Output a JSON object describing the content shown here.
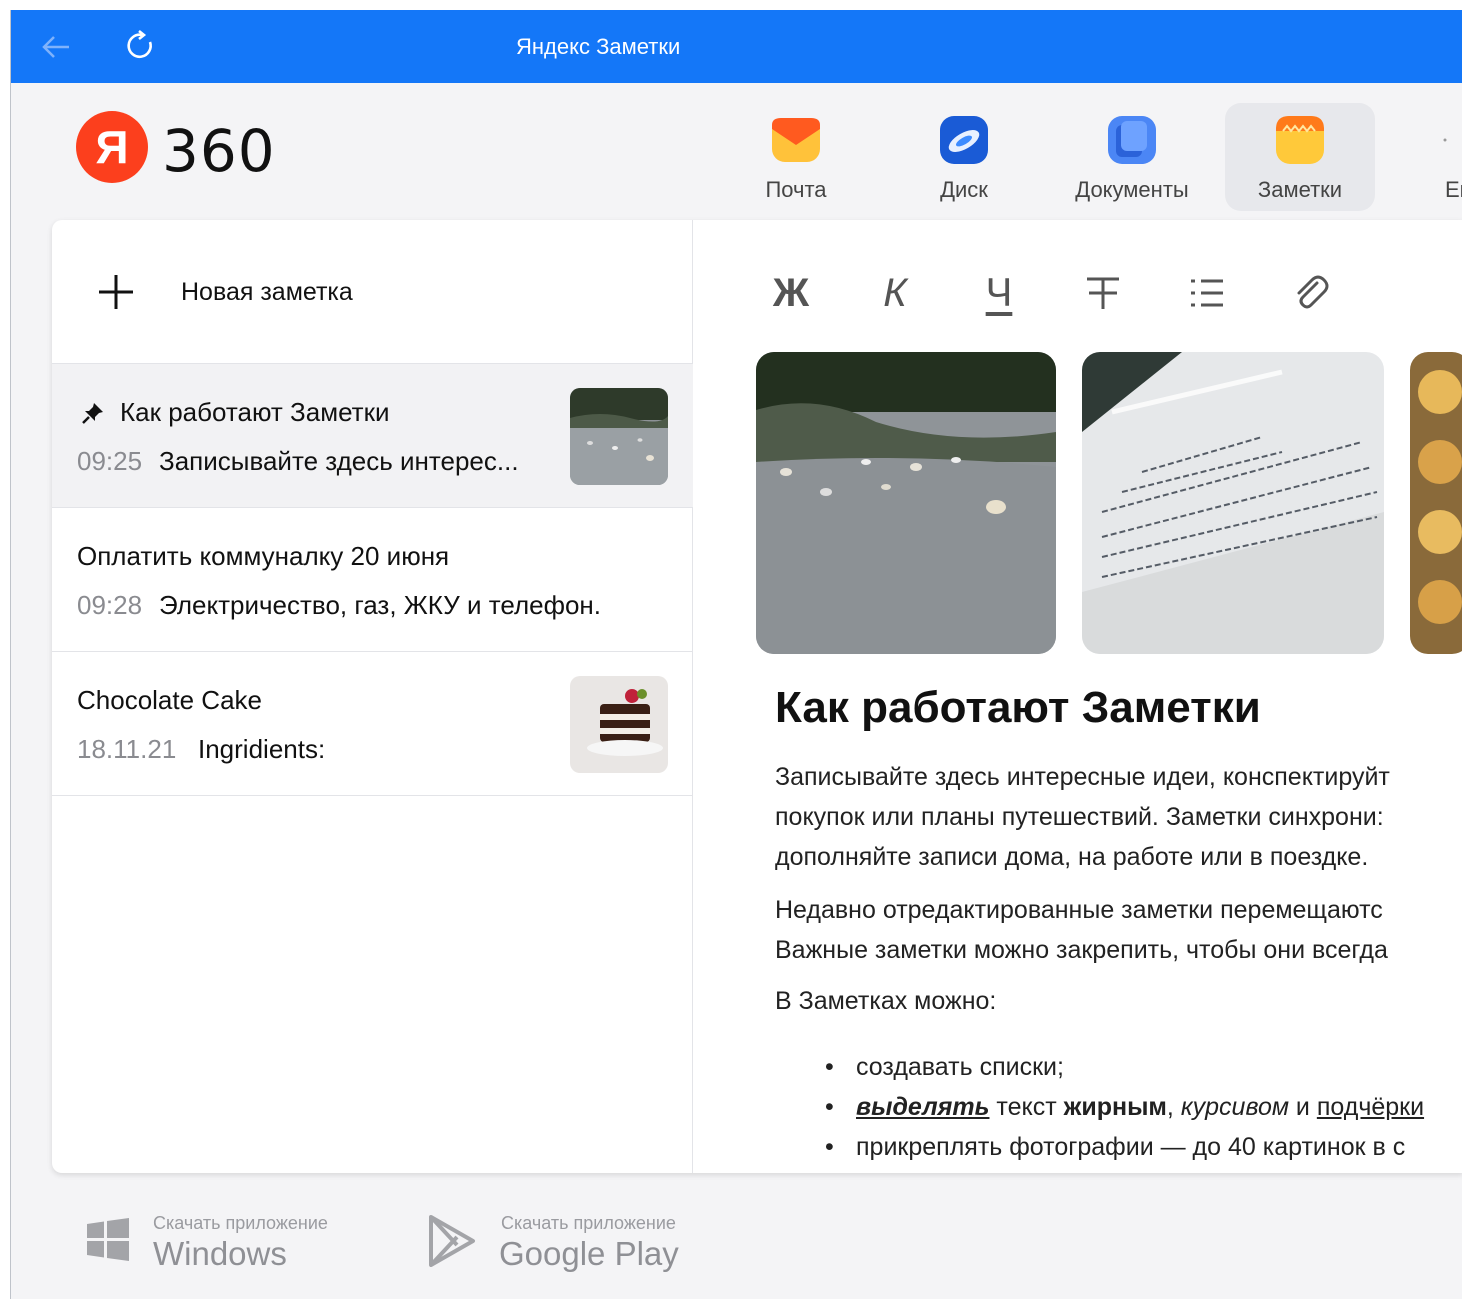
{
  "window": {
    "title": "Яндекс Заметки"
  },
  "logo": {
    "letter": "Я",
    "text": "360"
  },
  "services": [
    {
      "label": "Почта",
      "icon": "mail-icon"
    },
    {
      "label": "Диск",
      "icon": "disk-icon"
    },
    {
      "label": "Документы",
      "icon": "documents-icon"
    },
    {
      "label": "Заметки",
      "icon": "notes-icon",
      "active": true
    },
    {
      "label": "Ег",
      "icon": "more-icon"
    }
  ],
  "sidebar": {
    "new_note_label": "Новая заметка",
    "notes": [
      {
        "title": "Как работают Заметки",
        "time": "09:25",
        "snippet": "Записывайте здесь интерес...",
        "pinned": true,
        "selected": true
      },
      {
        "title": "Оплатить коммуналку 20 июня",
        "time": "09:28",
        "snippet": "Электричество, газ, ЖКУ и телефон."
      },
      {
        "title": "Chocolate Cake",
        "time": "18.11.21",
        "snippet": "Ingridients:"
      }
    ]
  },
  "toolbar": {
    "bold": "Ж",
    "italic": "К",
    "underline": "Ч",
    "strike": "Ŧ"
  },
  "document": {
    "title": "Как работают Заметки",
    "p1_l1": "Записывайте здесь интересные идеи, конспектируйт",
    "p1_l2": "покупок или планы путешествий. Заметки синхрони:",
    "p1_l3": "дополняйте записи дома, на работе или в поездке.",
    "p2_l1": "Недавно отредактированные заметки перемещаютс",
    "p2_l2": "Важные заметки можно закрепить, чтобы они всегда",
    "p3": "В Заметках можно:",
    "bullet1": "создавать списки;",
    "bullet2_a": "выделять",
    "bullet2_b": " текст ",
    "bullet2_c": "жирным",
    "bullet2_d": ", ",
    "bullet2_e": "курсивом",
    "bullet2_f": " и ",
    "bullet2_g": "подчёрки",
    "bullet3": "прикреплять фотографии — до 40 картинок в с"
  },
  "footer": {
    "windows": {
      "small": "Скачать приложение",
      "big": "Windows"
    },
    "google": {
      "small": "Скачать приложение",
      "big": "Google Play"
    }
  },
  "colors": {
    "titlebar": "#1477f8",
    "logo_red": "#fc3f1d",
    "active_tab_bg": "#e7e8ec"
  }
}
